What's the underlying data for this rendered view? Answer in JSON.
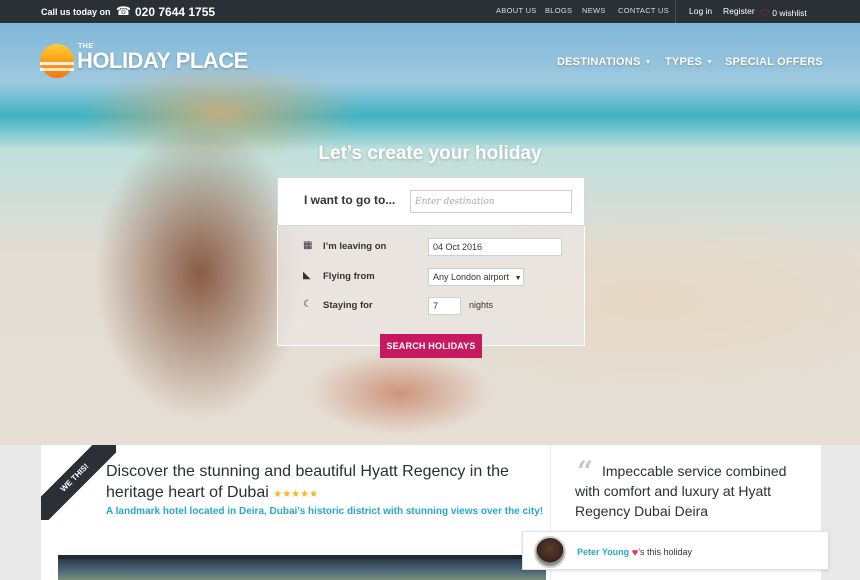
{
  "topbar": {
    "call_label": "Call us today on",
    "phone": "020 7644 1755",
    "links": [
      "ABOUT US",
      "BLOGS",
      "NEWS",
      "CONTACT US"
    ],
    "login": "Log in",
    "register": "Register",
    "wishlist": "0 wishlist"
  },
  "brand": {
    "the": "THE",
    "name": "HOLIDAY PLACE"
  },
  "nav": {
    "destinations": "DESTINATIONS",
    "types": "TYPES",
    "special_offers": "SPECIAL OFFERS"
  },
  "hero": {
    "headline": "Let’s create your holiday"
  },
  "search": {
    "go_label": "I want to go to...",
    "destination_placeholder": "Enter destination",
    "leaving_label": "I’m leaving on",
    "leaving_value": "04 Oct 2016",
    "flying_label": "Flying from",
    "flying_value": "Any London airport",
    "staying_label": "Staying for",
    "staying_value": "7",
    "nights_label": "nights",
    "button": "SEARCH HOLIDAYS"
  },
  "feature": {
    "ribbon": "WE THIS!",
    "title": "Discover the stunning and beautiful Hyatt Regency in the heritage heart of Dubai",
    "stars": "★★★★★",
    "subtitle": "A landmark hotel located in Deira, Dubai's historic district with stunning views over the city!",
    "quote": "Impeccable service combined with comfort and luxury at Hyatt Regency Dubai Deira"
  },
  "testimonial": {
    "name": "Peter Young",
    "suffix": "'s this holiday"
  },
  "colors": {
    "topbar": "#2b2f36",
    "accent_pink": "#c8185f",
    "link_blue": "#28a8c8",
    "star": "#f2b81b"
  }
}
